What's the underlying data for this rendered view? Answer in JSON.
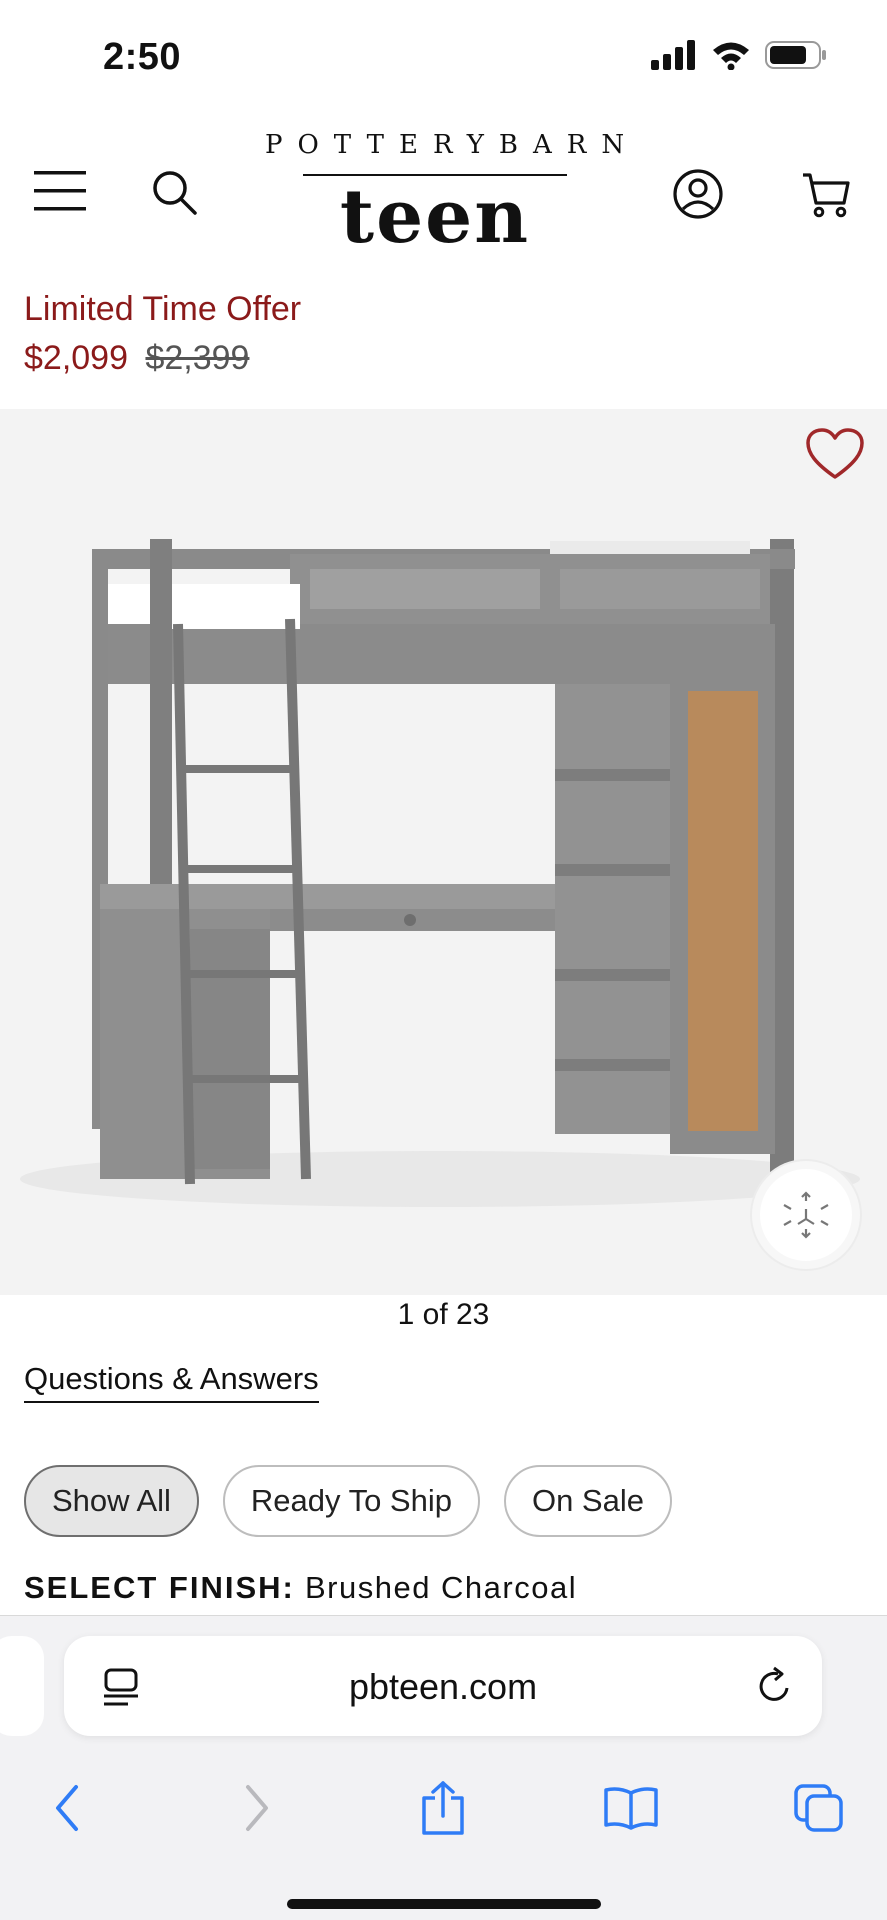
{
  "status": {
    "time": "2:50"
  },
  "brand": {
    "top": "POTTERYBARN",
    "bottom": "teen"
  },
  "offer": {
    "label": "Limited Time Offer",
    "sale_price": "$2,099",
    "original_price": "$2,399"
  },
  "gallery": {
    "counter": "1 of 23"
  },
  "links": {
    "qa": "Questions & Answers"
  },
  "filters": [
    {
      "label": "Show All",
      "active": true
    },
    {
      "label": "Ready To Ship",
      "active": false
    },
    {
      "label": "On Sale",
      "active": false
    }
  ],
  "finish": {
    "label": "SELECT FINISH:",
    "value": "Brushed Charcoal"
  },
  "browser": {
    "url": "pbteen.com"
  },
  "colors": {
    "accent": "#8b1a1a",
    "safari_blue": "#2f7cf6"
  },
  "icons": [
    "menu-icon",
    "search-icon",
    "account-icon",
    "cart-icon",
    "heart-icon",
    "3d-view-icon",
    "reader-icon",
    "reload-icon",
    "back-icon",
    "forward-icon",
    "share-icon",
    "bookmarks-icon",
    "tabs-icon"
  ]
}
